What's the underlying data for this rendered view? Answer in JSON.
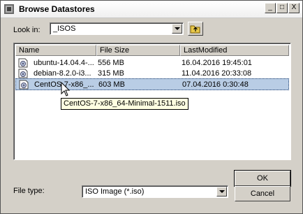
{
  "window": {
    "title": "Browse Datastores",
    "controls": {
      "minimize": "_",
      "maximize": "□",
      "close": "X"
    }
  },
  "look_in": {
    "label": "Look in:",
    "value": "_ISOS"
  },
  "listview": {
    "columns": [
      "Name",
      "File Size",
      "LastModified"
    ],
    "rows": [
      {
        "name": "ubuntu-14.04.4-...",
        "size": "556 MB",
        "modified": "16.04.2016 19:45:01"
      },
      {
        "name": "debian-8.2.0-i3...",
        "size": "315 MB",
        "modified": "11.04.2016 20:33:08"
      },
      {
        "name": "CentOS-7-x86_...",
        "size": "603 MB",
        "modified": "07.04.2016 0:30:48"
      }
    ]
  },
  "tooltip": "CentOS-7-x86_64-Minimal-1511.iso",
  "file_type": {
    "label": "File type:",
    "value": "ISO Image (*.iso)"
  },
  "buttons": {
    "ok": "OK",
    "cancel": "Cancel"
  },
  "colors": {
    "selection": "#b9cde5",
    "tooltip_bg": "#ffffe1",
    "dialog_bg": "#d4d0c8"
  }
}
